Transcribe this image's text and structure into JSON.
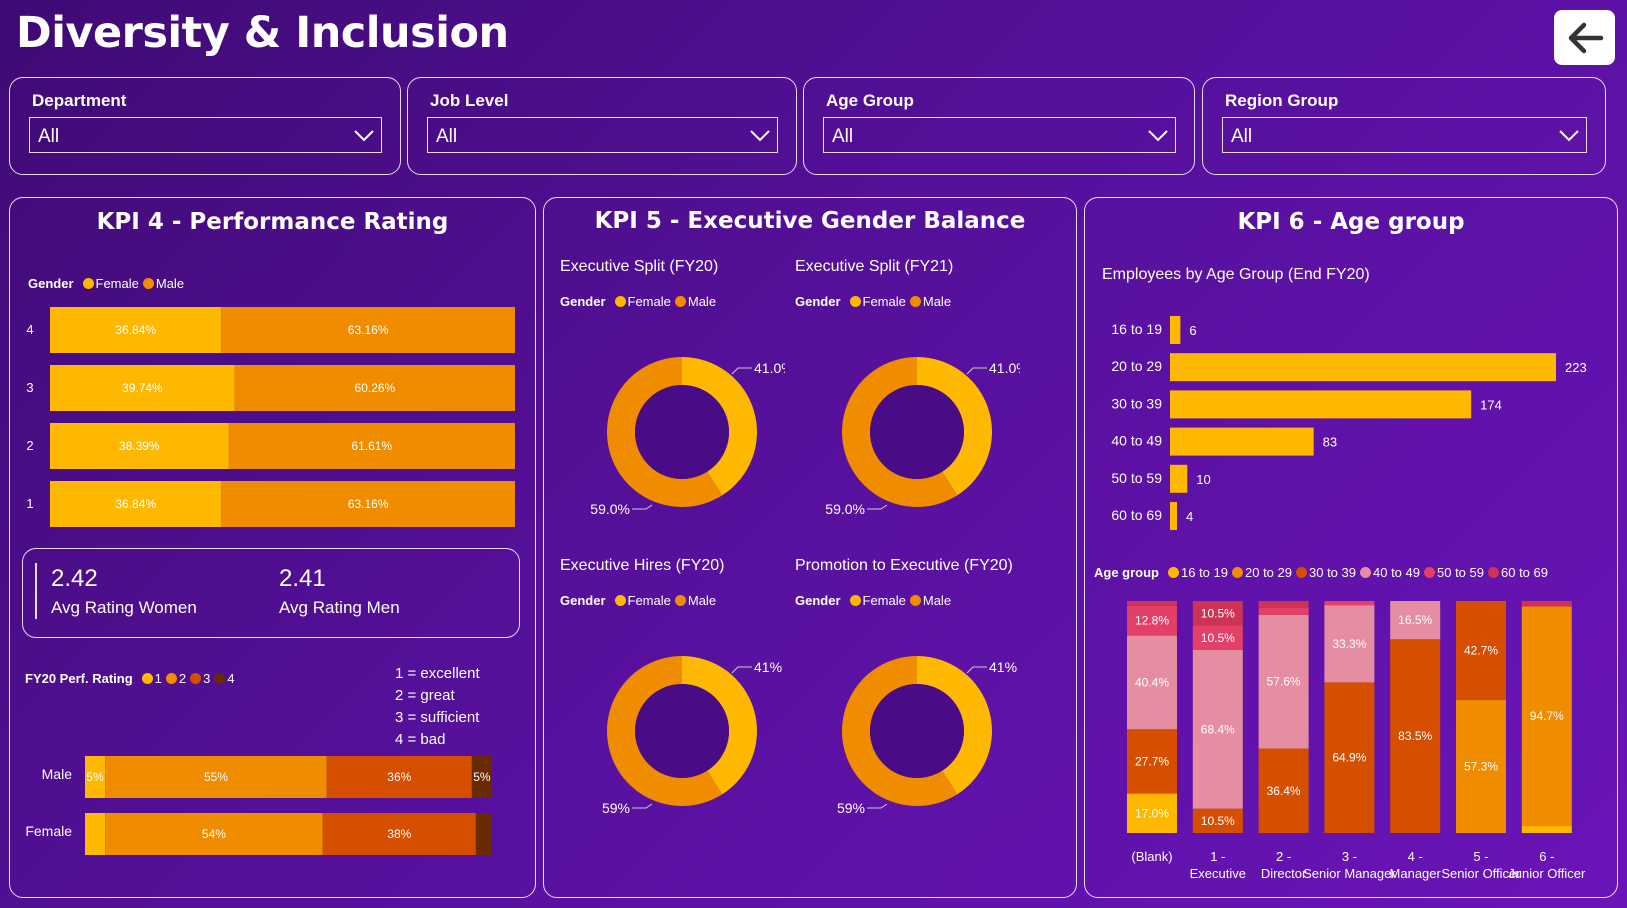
{
  "header": {
    "title": "Diversity & Inclusion"
  },
  "filters": [
    {
      "label": "Department",
      "value": "All"
    },
    {
      "label": "Job Level",
      "value": "All"
    },
    {
      "label": "Age Group",
      "value": "All"
    },
    {
      "label": "Region Group",
      "value": "All"
    }
  ],
  "colors": {
    "female": "#ffb800",
    "male": "#f08c00",
    "rating": [
      "#ffb800",
      "#f08c00",
      "#d64f00",
      "#6a2a00"
    ],
    "age": [
      "#ffb800",
      "#f08c00",
      "#d64f00",
      "#e58ea2",
      "#e34068",
      "#cc3355"
    ],
    "donut_center": "#4a0b86"
  },
  "kpi4": {
    "title": "KPI 4 - Performance Rating",
    "legend": {
      "title": "Gender",
      "items": [
        "Female",
        "Male"
      ]
    },
    "rating_legend": {
      "title": "FY20 Perf. Rating",
      "items": [
        "1",
        "2",
        "3",
        "4"
      ]
    },
    "notes": [
      "1 = excellent",
      "2 = great",
      "3 = sufficient",
      "4 = bad"
    ],
    "avg_women": {
      "value": "2.42",
      "label": "Avg Rating Women"
    },
    "avg_men": {
      "value": "2.41",
      "label": "Avg Rating Men"
    }
  },
  "kpi5": {
    "title": "KPI 5 - Executive Gender Balance",
    "legend_title": "Gender",
    "legend_items": [
      "Female",
      "Male"
    ],
    "charts": [
      {
        "title": "Executive Split (FY20)",
        "female_label": "41.0%",
        "male_label": "59.0%"
      },
      {
        "title": "Executive Split (FY21)",
        "female_label": "41.0%",
        "male_label": "59.0%"
      },
      {
        "title": "Executive Hires (FY20)",
        "female_label": "41%",
        "male_label": "59%"
      },
      {
        "title": "Promotion to Executive (FY20)",
        "female_label": "41%",
        "male_label": "59%"
      }
    ]
  },
  "kpi6": {
    "title": "KPI 6 - Age group",
    "chart_title": "Employees by Age Group (End FY20)",
    "legend_title": "Age group",
    "legend_items": [
      "16 to 19",
      "20 to 29",
      "30 to 39",
      "40 to 49",
      "50 to 59",
      "60 to 69"
    ]
  },
  "chart_data": [
    {
      "type": "bar",
      "orientation": "horizontal-stacked-100",
      "categories": [
        "4",
        "3",
        "2",
        "1"
      ],
      "series": [
        {
          "name": "Female",
          "values": [
            36.84,
            39.74,
            38.39,
            36.84
          ],
          "labels": [
            "36.84%",
            "39.74%",
            "38.39%",
            "36.84%"
          ]
        },
        {
          "name": "Male",
          "values": [
            63.16,
            60.26,
            61.61,
            63.16
          ],
          "labels": [
            "63.16%",
            "60.26%",
            "61.61%",
            "63.16%"
          ]
        }
      ]
    },
    {
      "type": "bar",
      "orientation": "horizontal-stacked-100",
      "categories": [
        "Male",
        "Female"
      ],
      "series": [
        {
          "name": "1",
          "values": [
            5,
            5
          ],
          "labels": [
            "5%",
            ""
          ]
        },
        {
          "name": "2",
          "values": [
            55,
            54
          ],
          "labels": [
            "55%",
            "54%"
          ]
        },
        {
          "name": "3",
          "values": [
            36,
            38
          ],
          "labels": [
            "36%",
            "38%"
          ]
        },
        {
          "name": "4",
          "values": [
            5,
            4
          ],
          "labels": [
            "5%",
            ""
          ]
        }
      ]
    },
    {
      "type": "pie",
      "title": "Executive Split (FY20)",
      "series": [
        {
          "name": "Female",
          "value": 41.0
        },
        {
          "name": "Male",
          "value": 59.0
        }
      ]
    },
    {
      "type": "pie",
      "title": "Executive Split (FY21)",
      "series": [
        {
          "name": "Female",
          "value": 41.0
        },
        {
          "name": "Male",
          "value": 59.0
        }
      ]
    },
    {
      "type": "pie",
      "title": "Executive Hires (FY20)",
      "series": [
        {
          "name": "Female",
          "value": 41
        },
        {
          "name": "Male",
          "value": 59
        }
      ]
    },
    {
      "type": "pie",
      "title": "Promotion to Executive (FY20)",
      "series": [
        {
          "name": "Female",
          "value": 41
        },
        {
          "name": "Male",
          "value": 59
        }
      ]
    },
    {
      "type": "bar",
      "orientation": "horizontal",
      "title": "Employees by Age Group (End FY20)",
      "categories": [
        "16 to 19",
        "20 to 29",
        "30 to 39",
        "40 to 49",
        "50 to 59",
        "60 to 69"
      ],
      "values": [
        6,
        223,
        174,
        83,
        10,
        4
      ]
    },
    {
      "type": "bar",
      "orientation": "vertical-stacked-100",
      "categories": [
        "(Blank)",
        "1 - Executive",
        "2 - Director",
        "3 - Senior Manager",
        "4 - Manager",
        "5 - Senior Officer",
        "6 - Junior Officer"
      ],
      "series": [
        {
          "name": "16 to 19",
          "values": [
            17.0,
            0,
            0,
            0,
            0,
            0,
            3.0
          ],
          "labels": [
            "17.0%",
            "",
            "",
            "",
            "",
            "",
            ""
          ]
        },
        {
          "name": "20 to 29",
          "values": [
            0,
            0,
            0,
            0,
            0,
            57.3,
            94.7
          ],
          "labels": [
            "",
            "",
            "",
            "",
            "",
            "57.3%",
            "94.7%"
          ]
        },
        {
          "name": "30 to 39",
          "values": [
            27.7,
            10.5,
            36.4,
            64.9,
            83.5,
            42.7,
            0
          ],
          "labels": [
            "27.7%",
            "10.5%",
            "36.4%",
            "64.9%",
            "83.5%",
            "42.7%",
            ""
          ]
        },
        {
          "name": "40 to 49",
          "values": [
            40.4,
            68.4,
            57.6,
            33.3,
            16.5,
            0,
            0
          ],
          "labels": [
            "40.4%",
            "68.4%",
            "57.6%",
            "33.3%",
            "16.5%",
            "",
            ""
          ]
        },
        {
          "name": "50 to 59",
          "values": [
            12.8,
            10.5,
            3.0,
            1.8,
            0,
            0,
            0
          ],
          "labels": [
            "12.8%",
            "10.5%",
            "",
            "",
            "",
            "",
            ""
          ]
        },
        {
          "name": "60 to 69",
          "values": [
            2.1,
            10.6,
            3.0,
            0,
            0,
            0,
            2.3
          ],
          "labels": [
            "",
            "10.5%",
            "",
            "",
            "",
            "",
            ""
          ]
        }
      ]
    }
  ]
}
